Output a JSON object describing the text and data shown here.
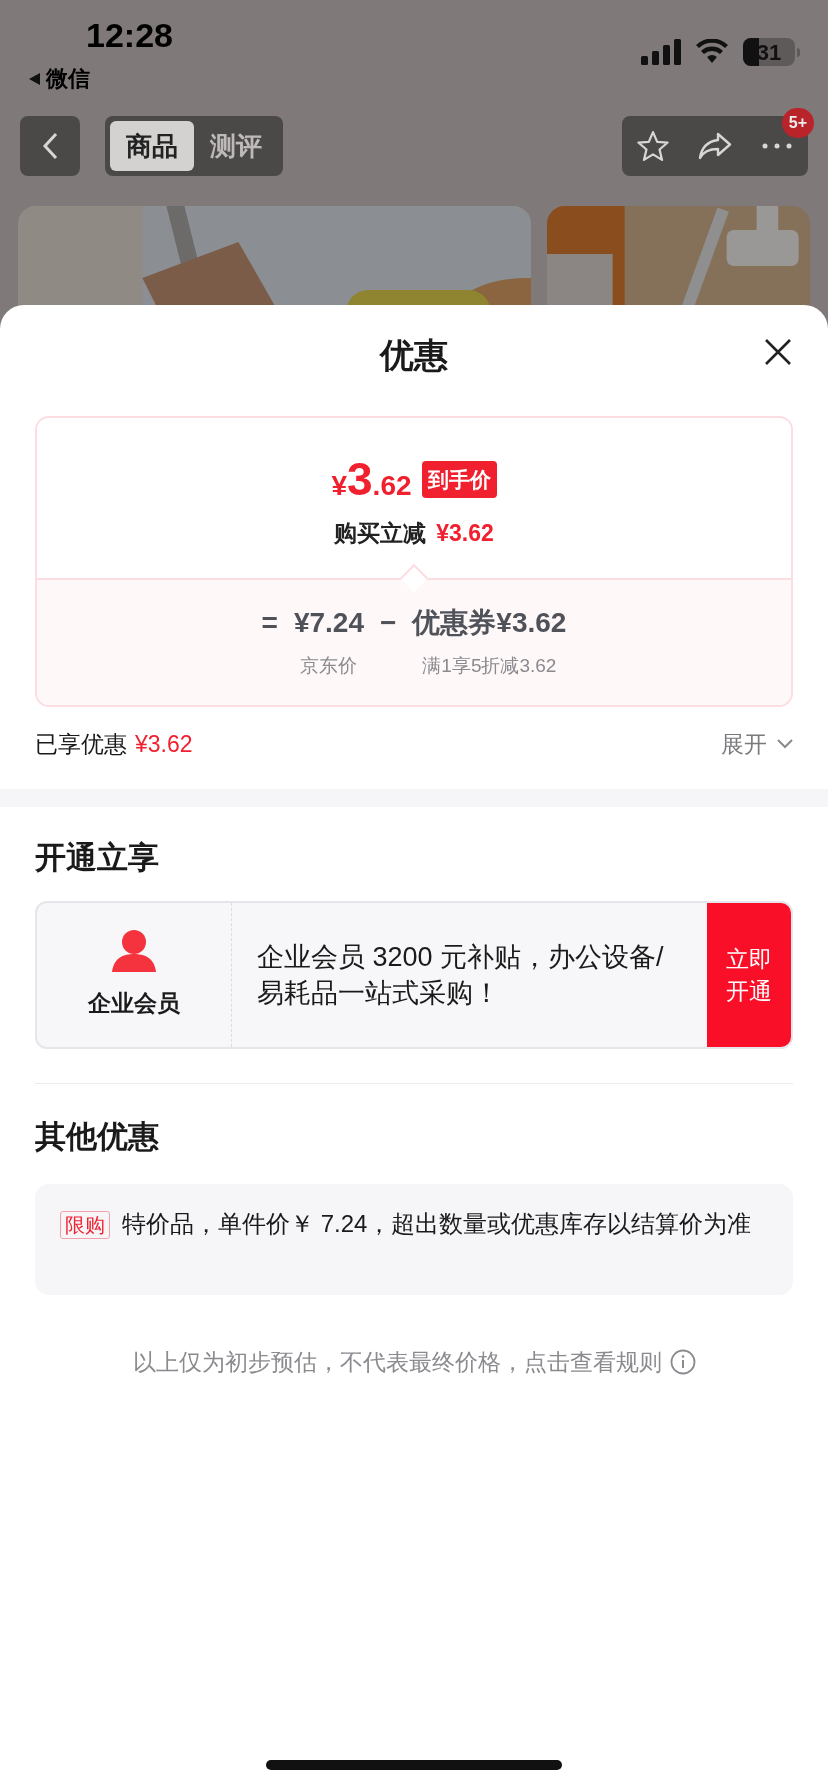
{
  "status_bar": {
    "time": "12:28",
    "back_label": "微信",
    "battery": "31"
  },
  "nav": {
    "tabs": [
      {
        "label": "商品",
        "selected": true
      },
      {
        "label": "测评",
        "selected": false
      }
    ],
    "badge": "5+"
  },
  "sheet": {
    "title": "优惠",
    "price_card": {
      "currency": "¥",
      "integer": "3",
      "decimal": ".62",
      "tag": "到手价",
      "reduce_label": "购买立减",
      "reduce_value": "¥3.62",
      "formula": {
        "equals": "=",
        "base_price": "¥7.24",
        "base_label": "京东价",
        "minus": "−",
        "coupon": "优惠券¥3.62",
        "coupon_label": "满1享5折减3.62"
      }
    },
    "enjoyed": {
      "label": "已享优惠",
      "value": "¥3.62",
      "toggle": "展开",
      "expanded": false
    },
    "open_section": {
      "title": "开通立享",
      "member_name": "企业会员",
      "description": "企业会员 3200 元补贴，办公设备/易耗品一站式采购！",
      "button": "立即开通"
    },
    "other_section": {
      "title": "其他优惠",
      "items": [
        {
          "tag": "限购",
          "text": "特价品，单件价￥ 7.24，超出数量或优惠库存以结算价为准"
        }
      ]
    },
    "footer": "以上仅为初步预估，不代表最终价格，点击查看规则"
  }
}
